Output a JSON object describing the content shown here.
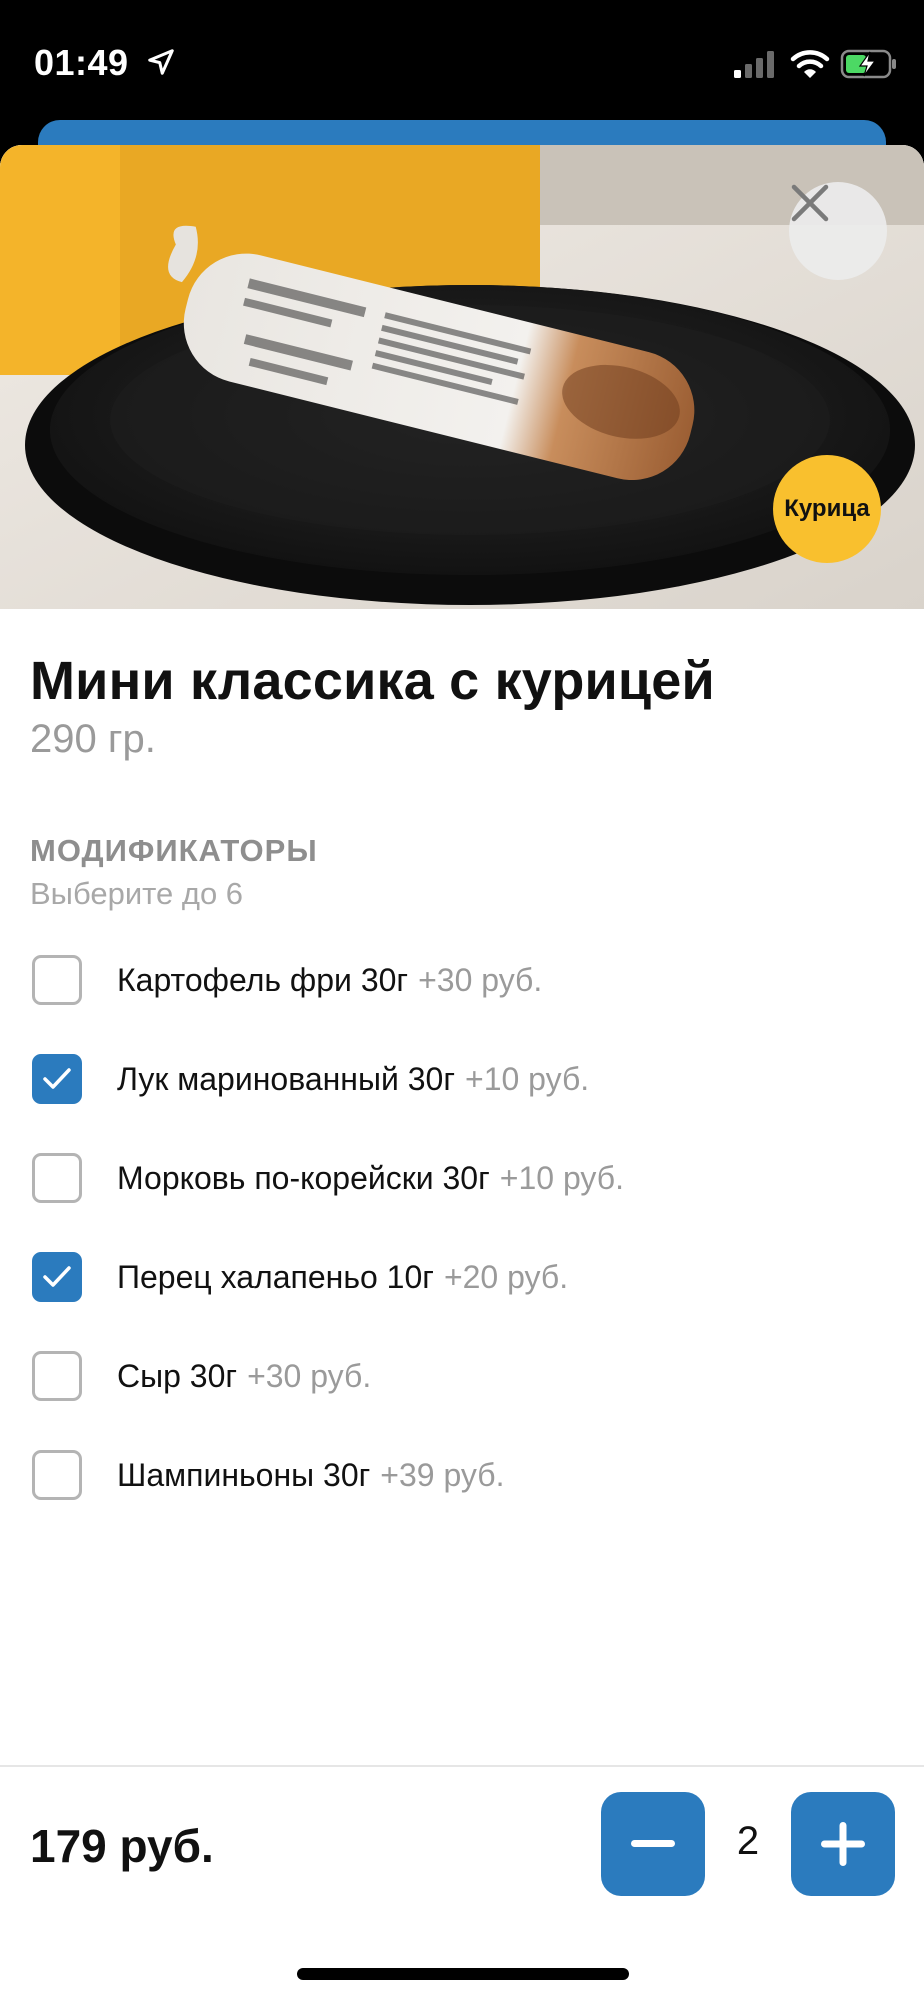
{
  "status_bar": {
    "time": "01:49",
    "icons": [
      "location-arrow-icon",
      "cellular-signal-icon",
      "wifi-icon",
      "battery-charging-icon"
    ]
  },
  "hero": {
    "image": "shawarma-wrap-on-black-plate",
    "close_icon": "close-icon",
    "badge_label": "Курица",
    "badge_color": "#F9C02E"
  },
  "product": {
    "title": "Мини классика с курицей",
    "weight": "290 гр."
  },
  "modifiers": {
    "title": "МОДИФИКАТОРЫ",
    "subtitle": "Выберите до 6",
    "items": [
      {
        "label": "Картофель фри 30г",
        "price": "+30 руб.",
        "checked": false
      },
      {
        "label": "Лук маринованный 30г",
        "price": "+10 руб.",
        "checked": true
      },
      {
        "label": "Морковь по-корейски 30г",
        "price": "+10 руб.",
        "checked": false
      },
      {
        "label": "Перец халапеньо 10г",
        "price": "+20 руб.",
        "checked": true
      },
      {
        "label": "Сыр 30г",
        "price": "+30 руб.",
        "checked": false
      },
      {
        "label": "Шампиньоны 30г",
        "price": "+39 руб.",
        "checked": false
      }
    ]
  },
  "footer": {
    "total": "179 руб.",
    "quantity": "2",
    "minus_icon": "minus-icon",
    "plus_icon": "plus-icon"
  },
  "colors": {
    "accent": "#2B7BBE",
    "badge": "#F9C02E",
    "muted_text": "#9a9a9a"
  }
}
